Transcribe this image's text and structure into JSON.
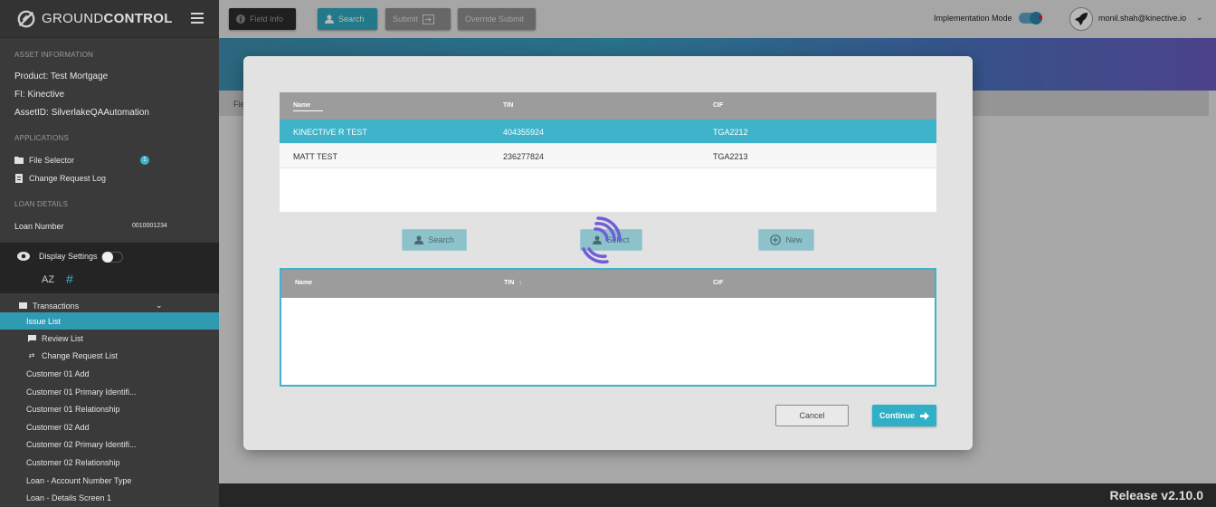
{
  "app": {
    "brand_light": "GROUND",
    "brand_bold": "CONTROL"
  },
  "sidebar": {
    "asset_info_heading": "ASSET INFORMATION",
    "product": "Product:  Test Mortgage",
    "fi": "FI:  Kinective",
    "asset_id": "AssetID:  SilverlakeQAAutomation",
    "applications_heading": "APPLICATIONS",
    "file_selector": "File Selector",
    "file_selector_badge": "1",
    "change_request_log": "Change Request Log",
    "loan_details_heading": "LOAN DETAILS",
    "loan_number_label": "Loan Number",
    "loan_number_value": "0010001234",
    "display_settings": "Display Settings",
    "sort_az": "AZ",
    "hash": "#",
    "transactions": "Transactions",
    "items": [
      "Issue List",
      "Review List",
      "Change Request List",
      "Customer 01 Add",
      "Customer 01 Primary Identifi...",
      "Customer 01 Relationship",
      "Customer 02 Add",
      "Customer 02 Primary Identifi...",
      "Customer 02 Relationship",
      "Loan - Account Number Type",
      "Loan - Details Screen 1"
    ]
  },
  "toolbar": {
    "field_info": "Field Info",
    "search": "Search",
    "submit": "Submit",
    "override_submit": "Override Submit",
    "implementation_mode": "Implementation Mode",
    "user_email": "monil.shah@kinective.io"
  },
  "background": {
    "subbar_text": "Fie"
  },
  "modal": {
    "results_headers": {
      "name": "Name",
      "tin": "TIN",
      "cif": "CIF"
    },
    "results_rows": [
      {
        "name": "KINECTIVE R TEST",
        "tin": "404355924",
        "cif": "TGA2212"
      },
      {
        "name": "MATT TEST",
        "tin": "236277824",
        "cif": "TGA2213"
      }
    ],
    "search_button": "Search",
    "select_button": "Select",
    "new_button": "New",
    "selected_headers": {
      "name": "Name",
      "tin": "TIN",
      "cif": "CIF"
    },
    "cancel_button": "Cancel",
    "continue_button": "Continue"
  },
  "footer": {
    "release": "Release v2.10.0"
  },
  "colors": {
    "accent": "#3eb3c9",
    "sidebar_bg": "#3a3a3a",
    "header_gray": "#9c9c9c"
  }
}
